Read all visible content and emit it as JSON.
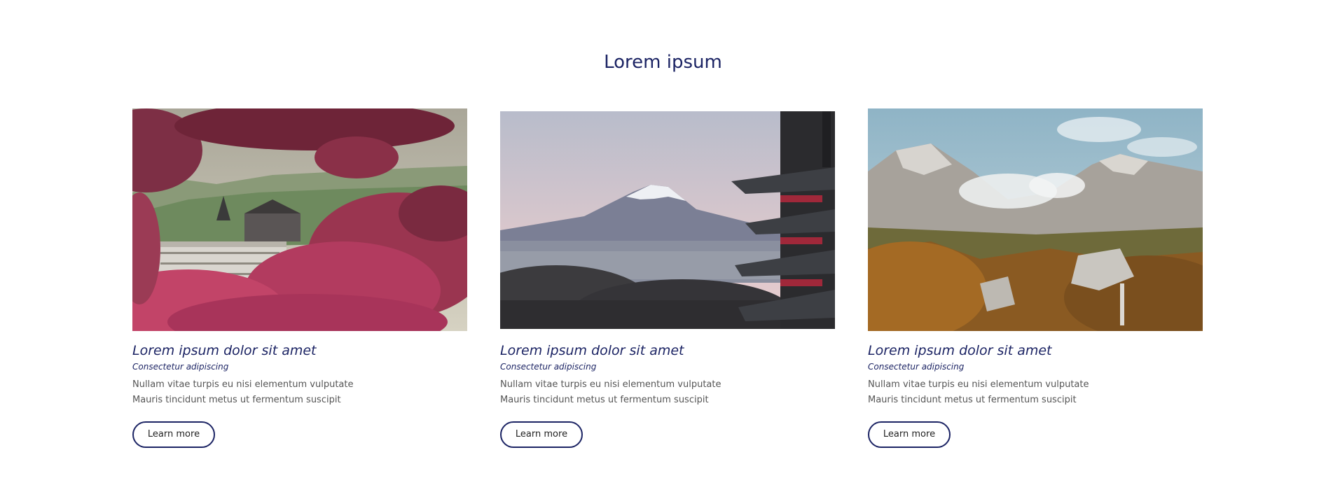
{
  "section": {
    "title": "Lorem ipsum"
  },
  "cards": [
    {
      "title": "Lorem ipsum dolor sit amet",
      "subtitle": "Consectetur adipiscing",
      "text_lines": [
        "Nullam vitae turpis eu nisi elementum vulputate",
        "Mauris tincidunt metus ut fermentum suscipit"
      ],
      "button_label": "Learn more",
      "image": "autumn-town-photo"
    },
    {
      "title": "Lorem ipsum dolor sit amet",
      "subtitle": "Consectetur adipiscing",
      "text_lines": [
        "Nullam vitae turpis eu nisi elementum vulputate",
        "Mauris tincidunt metus ut fermentum suscipit"
      ],
      "button_label": "Learn more",
      "image": "mount-fuji-pagoda-photo"
    },
    {
      "title": "Lorem ipsum dolor sit amet",
      "subtitle": "Consectetur adipiscing",
      "text_lines": [
        "Nullam vitae turpis eu nisi elementum vulputate",
        "Mauris tincidunt metus ut fermentum suscipit"
      ],
      "button_label": "Learn more",
      "image": "alpine-mountains-photo"
    }
  ],
  "colors": {
    "accent": "#1c2464",
    "body_text": "#555555",
    "background": "#ffffff"
  }
}
